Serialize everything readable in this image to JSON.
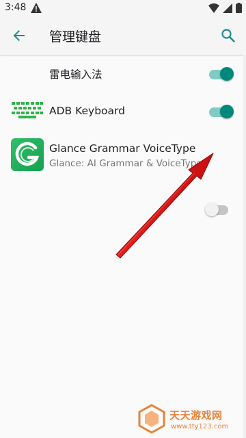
{
  "status_bar": {
    "time": "3:48"
  },
  "app_bar": {
    "title": "管理键盘"
  },
  "keyboards": [
    {
      "title": "雷电输入法",
      "subtitle": "",
      "enabled": true
    },
    {
      "title": "ADB Keyboard",
      "subtitle": "",
      "enabled": true
    },
    {
      "title": "Glance Grammar VoiceType",
      "subtitle": "Glance: AI Grammar & VoiceType",
      "enabled": false
    }
  ],
  "colors": {
    "accent": "#00897b",
    "accent_track": "#80cbc4",
    "annotation_arrow": "#d81c1c",
    "keyboard_icon": "#2fb34a",
    "watermark": "#e8833a"
  },
  "watermark": {
    "text": "天天游戏网",
    "url": "www.tty123.com"
  }
}
